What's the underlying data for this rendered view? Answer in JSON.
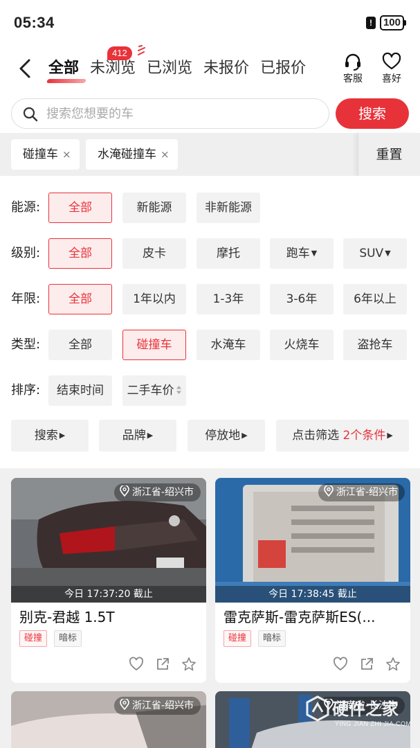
{
  "status_bar": {
    "time": "05:34",
    "battery": "100",
    "alert": "!"
  },
  "nav": {
    "tabs": [
      {
        "label": "全部",
        "active": true
      },
      {
        "label": "未浏览",
        "badge": "412"
      },
      {
        "label": "已浏览"
      },
      {
        "label": "未报价"
      },
      {
        "label": "已报价"
      }
    ],
    "service_label": "客服",
    "favorite_label": "喜好"
  },
  "search": {
    "placeholder": "搜索您想要的车",
    "button_label": "搜索"
  },
  "active_filters": {
    "chips": [
      "碰撞车",
      "水淹碰撞车"
    ],
    "remove_glyph": "×",
    "reset_label": "重置"
  },
  "filters": {
    "energy": {
      "label": "能源:",
      "options": [
        "全部",
        "新能源",
        "非新能源"
      ],
      "selected": "全部"
    },
    "level": {
      "label": "级别:",
      "options": [
        "全部",
        "皮卡",
        "摩托",
        "跑车",
        "SUV"
      ],
      "selected": "全部"
    },
    "age": {
      "label": "年限:",
      "options": [
        "全部",
        "1年以内",
        "1-3年",
        "3-6年",
        "6年以上"
      ],
      "selected": "全部"
    },
    "type": {
      "label": "类型:",
      "options": [
        "全部",
        "碰撞车",
        "水淹车",
        "火烧车",
        "盗抢车"
      ],
      "selected": "碰撞车"
    },
    "sort": {
      "label": "排序:",
      "options": [
        "结束时间",
        "二手车价"
      ]
    }
  },
  "shortcuts": {
    "search": "搜索",
    "brand": "品牌",
    "location": "停放地",
    "filter_prefix": "点击筛选",
    "filter_count": "2个条件"
  },
  "listings": [
    {
      "location": "浙江省-绍兴市",
      "deadline": "今日 17:37:20 截止",
      "title": "别克-君越  1.5T",
      "tags": [
        "碰撞",
        "暗标"
      ]
    },
    {
      "location": "浙江省-绍兴市",
      "deadline": "今日 17:38:45 截止",
      "title": "雷克萨斯-雷克萨斯ES(...",
      "tags": [
        "碰撞",
        "暗标"
      ]
    },
    {
      "location": "浙江省-绍兴市"
    },
    {
      "location": "湖南省-长沙市"
    }
  ],
  "watermark": {
    "name": "硬件之家",
    "pinyin": "YING JIAN ZHI JIA.COM"
  },
  "colors": {
    "accent": "#e8323a",
    "selected_bg": "#fdecec"
  }
}
